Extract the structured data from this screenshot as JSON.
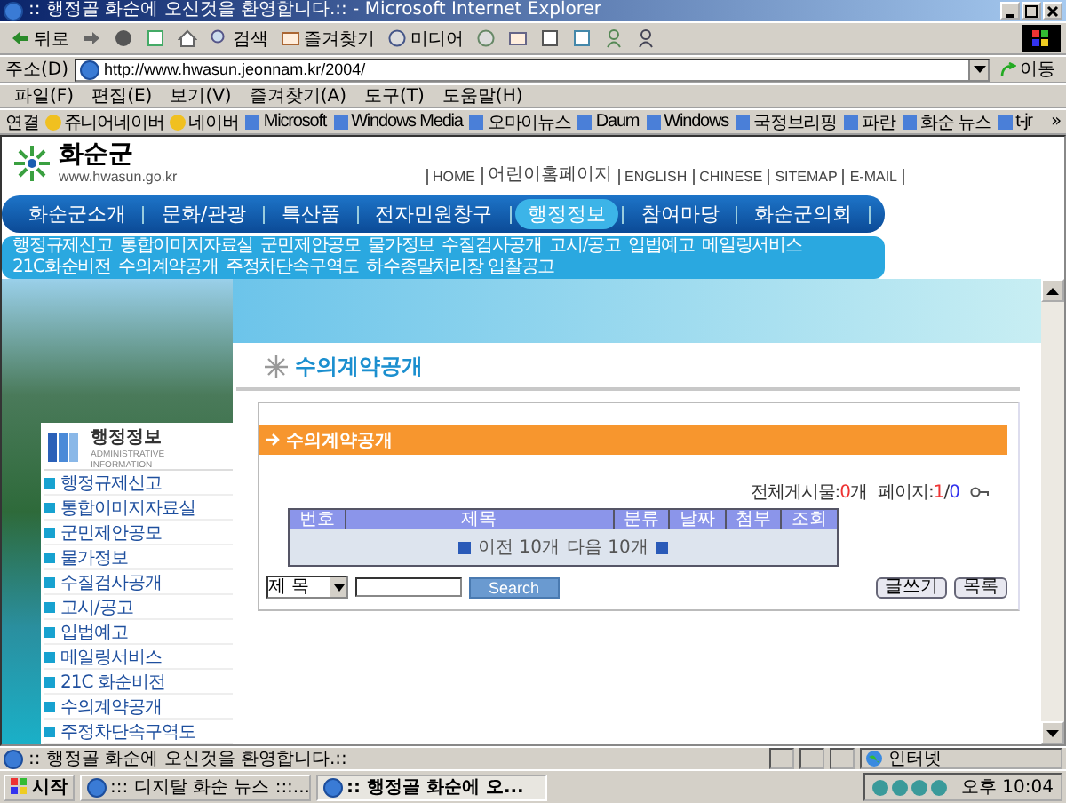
{
  "window": {
    "title": ":: 행정골 화순에 오신것을 환영합니다.:: - Microsoft Internet Explorer"
  },
  "toolbar": {
    "buttons": [
      {
        "kind": "back",
        "label": "뒤로"
      },
      {
        "kind": "forward"
      },
      {
        "kind": "stop"
      },
      {
        "kind": "refresh"
      },
      {
        "kind": "home"
      },
      {
        "kind": "search",
        "label": "검색"
      },
      {
        "kind": "favorites",
        "label": "즐겨찾기"
      },
      {
        "kind": "media",
        "label": "미디어"
      },
      {
        "kind": "history"
      },
      {
        "kind": "mail"
      },
      {
        "kind": "print"
      },
      {
        "kind": "edit"
      },
      {
        "kind": "discuss"
      },
      {
        "kind": "messenger"
      }
    ]
  },
  "address": {
    "label": "주소(D)",
    "url": "http://www.hwasun.jeonnam.kr/2004/",
    "go": "이동"
  },
  "menu": [
    "파일(F)",
    "편집(E)",
    "보기(V)",
    "즐겨찾기(A)",
    "도구(T)",
    "도움말(H)"
  ],
  "links": {
    "label": "연결",
    "items": [
      {
        "label": "쥬니어네이버",
        "kind": "naver"
      },
      {
        "label": "네이버",
        "kind": "naver"
      },
      {
        "label": "Microsoft",
        "kind": "page"
      },
      {
        "label": "Windows Media",
        "kind": "page"
      },
      {
        "label": "오마이뉴스",
        "kind": "page"
      },
      {
        "label": "Daum",
        "kind": "page"
      },
      {
        "label": "Windows",
        "kind": "page"
      },
      {
        "label": "국정브리핑",
        "kind": "page"
      },
      {
        "label": "파란",
        "kind": "page"
      },
      {
        "label": "화순 뉴스",
        "kind": "page"
      },
      {
        "label": "t-jr",
        "kind": "page"
      }
    ],
    "more": "»"
  },
  "site": {
    "logo": {
      "name": "화순군",
      "url": "www.hwasun.go.kr"
    },
    "top_links": [
      "HOME",
      "어린이홈페이지",
      "ENGLISH",
      "CHINESE",
      "SITEMAP",
      "E-MAIL"
    ],
    "nav": [
      {
        "label": "화순군소개",
        "selected": false
      },
      {
        "label": "문화/관광",
        "selected": false
      },
      {
        "label": "특산품",
        "selected": false
      },
      {
        "label": "전자민원창구",
        "selected": false
      },
      {
        "label": "행정정보",
        "selected": true
      },
      {
        "label": "참여마당",
        "selected": false
      },
      {
        "label": "화순군의회",
        "selected": false
      }
    ],
    "subnav": [
      "행정규제신고",
      "통합이미지자료실",
      "군민제안공모",
      "물가정보",
      "수질검사공개",
      "고시/공고",
      "입법예고",
      "메일링서비스",
      "21C화순비전",
      "수의계약공개",
      "주정차단속구역도",
      "하수종말처리장 입찰공고"
    ]
  },
  "sidebar": {
    "title": "행정정보",
    "subtitle": "ADMINISTRATIVE INFORMATION",
    "items": [
      "행정규제신고",
      "통합이미지자료실",
      "군민제안공모",
      "물가정보",
      "수질검사공개",
      "고시/공고",
      "입법예고",
      "메일링서비스",
      "21C 화순비전",
      "수의계약공개",
      "주정차단속구역도"
    ]
  },
  "content": {
    "page_title": "수의계약공개",
    "section_title": "수의계약공개",
    "count": {
      "label": "전체게시물:",
      "value": "0",
      "unit": "개"
    },
    "page": {
      "label": "페이지:",
      "current": "1",
      "separator": "/",
      "total": "0"
    },
    "table": {
      "columns": [
        "번호",
        "제목",
        "분류",
        "날짜",
        "첨부",
        "조회"
      ]
    },
    "pager": {
      "previous": "이전 10개",
      "next": "다음 10개"
    },
    "search": {
      "field": "제 목",
      "button": "Search"
    },
    "buttons": [
      "글쓰기",
      "목록"
    ]
  },
  "status_bar": {
    "text": ":: 행정골 화순에 오신것을 환영합니다.::",
    "zone": "인터넷"
  },
  "taskbar": {
    "start": "시작",
    "tasks": [
      {
        "label": "::: 디지탈 화순 뉴스 :::...",
        "selected": false
      },
      {
        "label": ":: 행정골 화순에 오...",
        "selected": true
      }
    ],
    "clock": "오후 10:04"
  }
}
